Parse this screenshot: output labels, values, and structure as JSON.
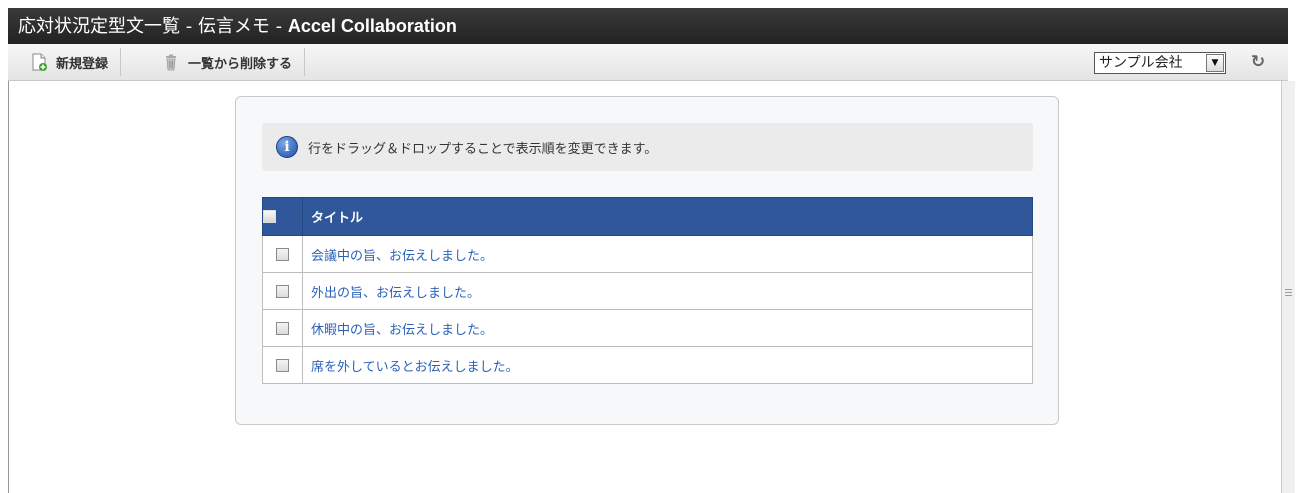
{
  "window": {
    "title_prefix": "応対状況定型文一覧 - 伝言メモ - ",
    "app_name": "Accel Collaboration"
  },
  "toolbar": {
    "new_label": "新規登録",
    "delete_label": "一覧から削除する",
    "company_selected": "サンプル会社",
    "refresh_icon": "↻"
  },
  "info": {
    "icon": "i",
    "message": "行をドラッグ＆ドロップすることで表示順を変更できます。"
  },
  "table": {
    "header_title": "タイトル",
    "rows": [
      {
        "title": "会議中の旨、お伝えしました。"
      },
      {
        "title": "外出の旨、お伝えしました。"
      },
      {
        "title": "休暇中の旨、お伝えしました。"
      },
      {
        "title": "席を外しているとお伝えしました。"
      }
    ]
  },
  "colors": {
    "header_bg": "#2f579a",
    "link": "#2b62b8",
    "titlebar_bg": "#222222"
  }
}
